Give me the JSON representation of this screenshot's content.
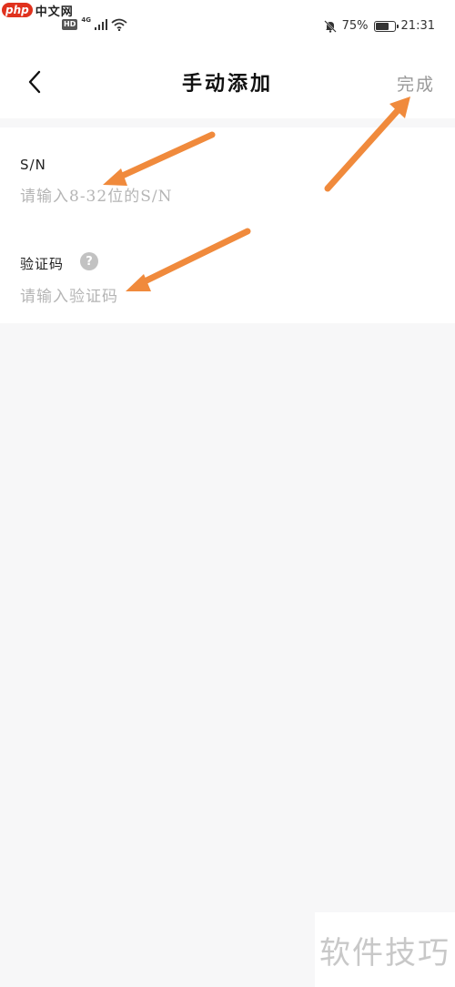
{
  "site_logo": {
    "php": "php",
    "cn": "中文网"
  },
  "status_bar": {
    "hd": "HD",
    "network": "4G",
    "battery_percent": "75%",
    "battery_level": 0.75,
    "time": "21:31"
  },
  "nav": {
    "title": "手动添加",
    "done_label": "完成"
  },
  "form": {
    "sn": {
      "label": "S/N",
      "value": "",
      "placeholder": "请输入8-32位的S/N"
    },
    "code": {
      "label": "验证码",
      "help": "?",
      "value": "",
      "placeholder": "请输入验证码"
    }
  },
  "annotations": {
    "arrow_color": "#f08a3c"
  },
  "watermark": "软件技巧"
}
